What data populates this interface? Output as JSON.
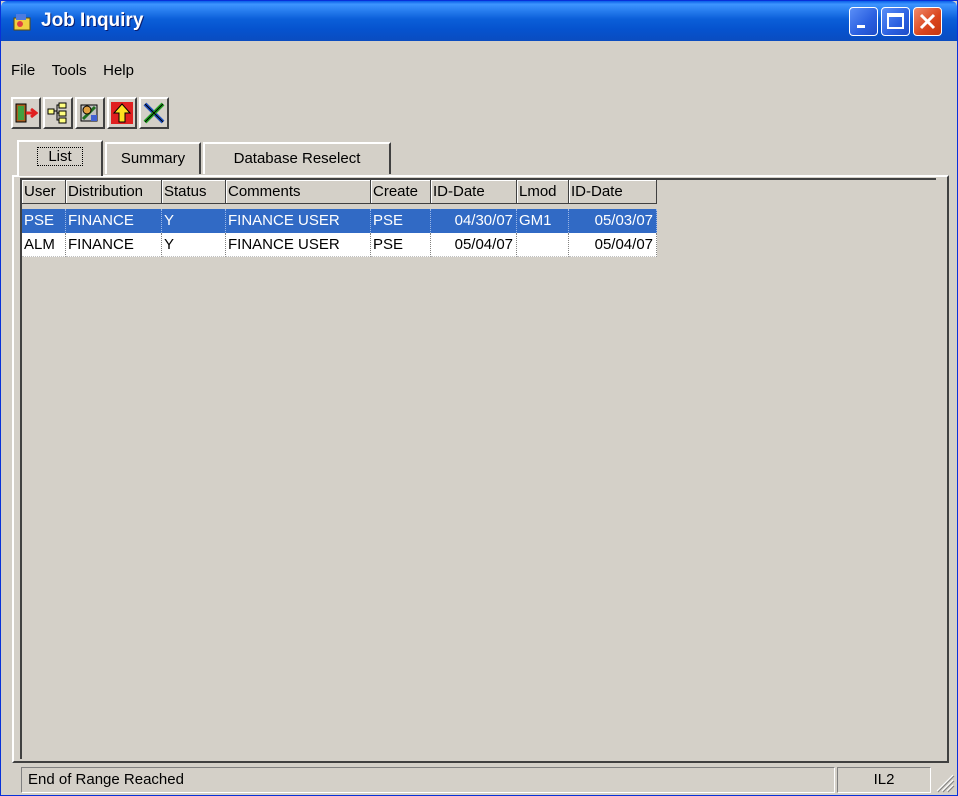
{
  "window": {
    "title": "Job Inquiry",
    "title_bar_color": "#0a5fe8",
    "controls": [
      "minimize-icon",
      "maximize-icon",
      "close-icon"
    ]
  },
  "menu": [
    {
      "label": "File"
    },
    {
      "label": "Tools"
    },
    {
      "label": "Help"
    }
  ],
  "toolbar": [
    {
      "icon": "exit-door-icon"
    },
    {
      "icon": "tree-structure-icon"
    },
    {
      "icon": "tool-settings-icon"
    },
    {
      "icon": "up-arrow-icon"
    },
    {
      "icon": "cross-tools-icon"
    }
  ],
  "tabs": [
    {
      "label": "List",
      "selected": true
    },
    {
      "label": "Summary",
      "selected": false
    },
    {
      "label": "Database Reselect",
      "selected": false
    }
  ],
  "table": {
    "columns": [
      "User",
      "Distribution",
      "Status",
      "Comments",
      "Create",
      "ID-Date",
      "Lmod",
      "ID-Date"
    ],
    "rows": [
      [
        "PSE",
        "FINANCE",
        "Y",
        "FINANCE USER",
        "PSE",
        "04/30/07",
        "GM1",
        "05/03/07"
      ],
      [
        "ALM",
        "FINANCE",
        "Y",
        "FINANCE USER",
        "PSE",
        "05/04/07",
        "",
        "05/04/07"
      ]
    ],
    "selected_row": 0,
    "selection_color": "#316ac5"
  },
  "status": {
    "message": "End of Range Reached",
    "code": "IL2"
  }
}
